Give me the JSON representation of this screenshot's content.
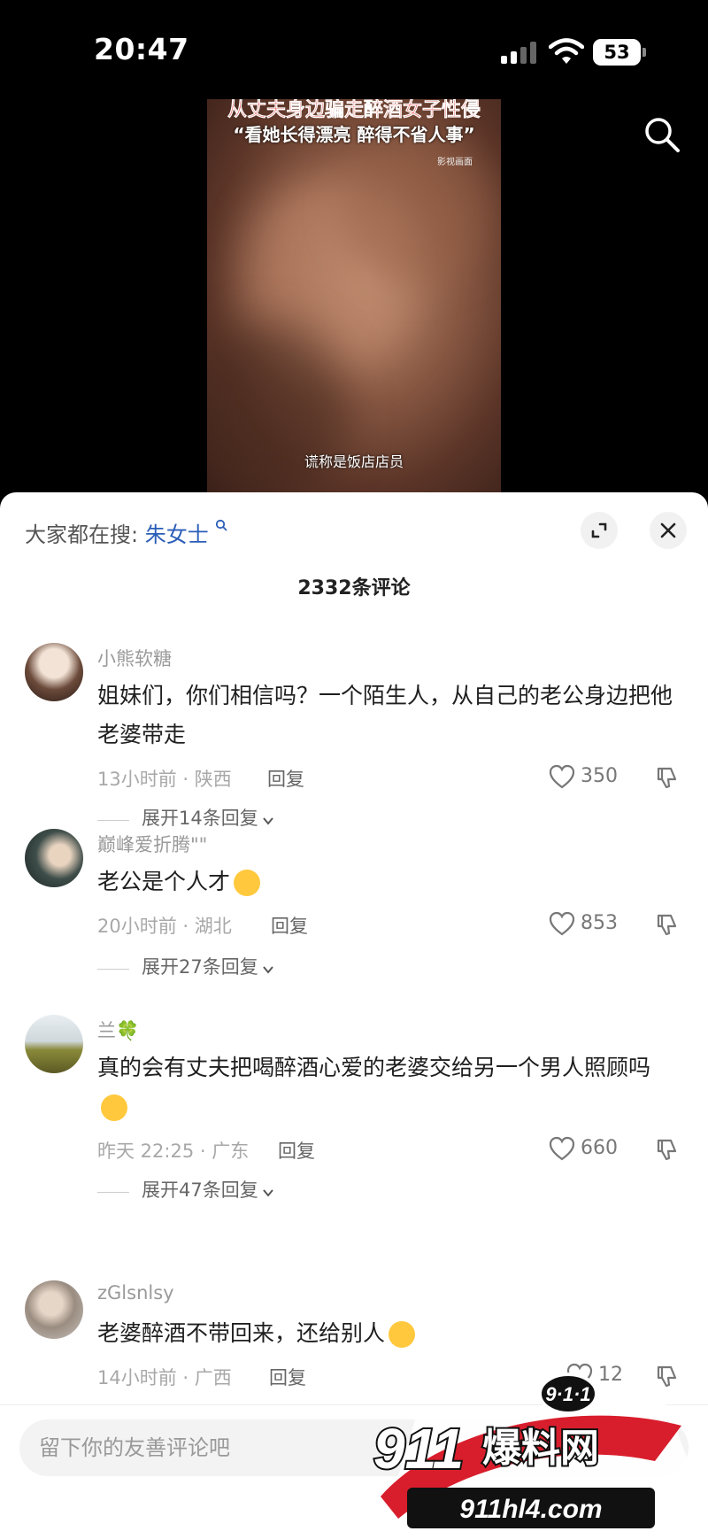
{
  "status": {
    "time": "20:47",
    "battery": "53"
  },
  "video": {
    "caption_line1": "从丈夫身边骗走醉酒女子性侵",
    "caption_line2": "“看她长得漂亮 醉得不省人事”",
    "tag": "影视画面",
    "subtitle": "谎称是饭店店员"
  },
  "sheet": {
    "hot_search_label": "大家都在搜:",
    "hot_search_keyword": "朱女士",
    "comment_count": "2332条评论",
    "reply_label": "回复"
  },
  "comments": [
    {
      "username": "小熊软糖",
      "text": "姐妹们，你们相信吗？一个陌生人，从自己的老公身边把他老婆带走",
      "meta": "13小时前 · 陕西",
      "likes": "350",
      "expand": "展开14条回复"
    },
    {
      "username": "巅峰爱折腾\"\"",
      "text": "老公是个人才",
      "meta": "20小时前 · 湖北",
      "likes": "853",
      "expand": "展开27条回复"
    },
    {
      "username": "兰🍀",
      "text": "真的会有丈夫把喝醉酒心爱的老婆交给另一个男人照顾吗",
      "meta": "昨天 22:25 · 广东",
      "likes": "660",
      "expand": "展开47条回复"
    },
    {
      "username": "zGlsnlsy",
      "text": "老婆醉酒不带回来，还给别人",
      "meta": "14小时前 · 广西",
      "likes": "12"
    }
  ],
  "input": {
    "placeholder": "留下你的友善评论吧"
  },
  "logo": {
    "badge": "9·1·1",
    "brand": "911",
    "brand_cn": "爆料网",
    "domain": "911hl4.com"
  },
  "colors": {
    "keyword": "#2b5eb8",
    "caption_red": "#e53935",
    "logo_red": "#d81e2c"
  }
}
